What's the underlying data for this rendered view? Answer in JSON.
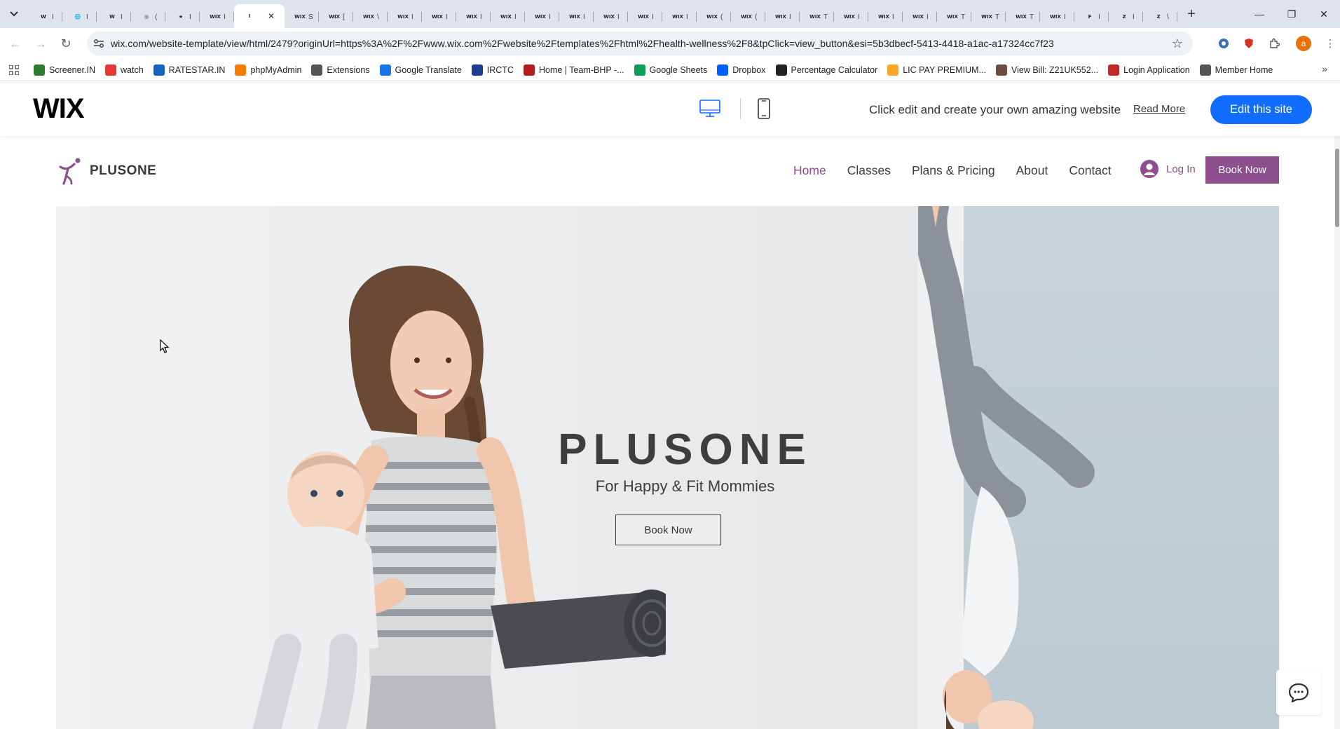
{
  "browser": {
    "tabs": [
      {
        "favicon": "W",
        "title": "I"
      },
      {
        "favicon": "🌐",
        "title": "I"
      },
      {
        "favicon": "W",
        "title": "I"
      },
      {
        "favicon": "◎",
        "title": "("
      },
      {
        "favicon": "★",
        "title": "I"
      },
      {
        "favicon": "WIX",
        "title": "I"
      },
      {
        "favicon": "I",
        "title": "",
        "active": true
      },
      {
        "favicon": "WIX",
        "title": "S"
      },
      {
        "favicon": "WIX",
        "title": "["
      },
      {
        "favicon": "WIX",
        "title": "\\"
      },
      {
        "favicon": "WIX",
        "title": "I"
      },
      {
        "favicon": "WIX",
        "title": "I"
      },
      {
        "favicon": "WIX",
        "title": "I"
      },
      {
        "favicon": "WIX",
        "title": "I"
      },
      {
        "favicon": "WIX",
        "title": "I"
      },
      {
        "favicon": "WIX",
        "title": "I"
      },
      {
        "favicon": "WIX",
        "title": "I"
      },
      {
        "favicon": "WIX",
        "title": "I"
      },
      {
        "favicon": "WIX",
        "title": "I"
      },
      {
        "favicon": "WIX",
        "title": "("
      },
      {
        "favicon": "WIX",
        "title": "("
      },
      {
        "favicon": "WIX",
        "title": "I"
      },
      {
        "favicon": "WIX",
        "title": "T"
      },
      {
        "favicon": "WIX",
        "title": "I"
      },
      {
        "favicon": "WIX",
        "title": "I"
      },
      {
        "favicon": "WIX",
        "title": "I"
      },
      {
        "favicon": "WIX",
        "title": "T"
      },
      {
        "favicon": "WIX",
        "title": "T"
      },
      {
        "favicon": "WIX",
        "title": "T"
      },
      {
        "favicon": "WIX",
        "title": "I"
      },
      {
        "favicon": "F",
        "title": "I"
      },
      {
        "favicon": "Z",
        "title": "I"
      },
      {
        "favicon": "Z",
        "title": "\\"
      }
    ],
    "url": "wix.com/website-template/view/html/2479?originUrl=https%3A%2F%2Fwww.wix.com%2Fwebsite%2Ftemplates%2Fhtml%2Fhealth-wellness%2F8&tpClick=view_button&esi=5b3dbecf-5413-4418-a1ac-a17324cc7f23",
    "profile_initial": "a",
    "bookmarks": [
      {
        "label": "Screener.IN",
        "icon": "bar-chart-icon",
        "color": "#2e7d32"
      },
      {
        "label": "watch",
        "icon": "youtube-icon",
        "color": "#e53935"
      },
      {
        "label": "RATESTAR.IN",
        "icon": "ratestar-icon",
        "color": "#1565c0"
      },
      {
        "label": "phpMyAdmin",
        "icon": "phpmyadmin-icon",
        "color": "#f57c00"
      },
      {
        "label": "Extensions",
        "icon": "puzzle-icon",
        "color": "#555555"
      },
      {
        "label": "Google Translate",
        "icon": "translate-icon",
        "color": "#1a73e8"
      },
      {
        "label": "IRCTC",
        "icon": "irctc-icon",
        "color": "#1a3f8f"
      },
      {
        "label": "Home | Team-BHP -...",
        "icon": "teambhp-icon",
        "color": "#b71c1c"
      },
      {
        "label": "Google Sheets",
        "icon": "sheets-icon",
        "color": "#0f9d58"
      },
      {
        "label": "Dropbox",
        "icon": "dropbox-icon",
        "color": "#0061fe"
      },
      {
        "label": "Percentage Calculator",
        "icon": "percent-icon",
        "color": "#222222"
      },
      {
        "label": "LIC PAY PREMIUM...",
        "icon": "lic-icon",
        "color": "#f9a825"
      },
      {
        "label": "View Bill: Z21UK552...",
        "icon": "bill-icon",
        "color": "#6d4c41"
      },
      {
        "label": "Login Application",
        "icon": "login-app-icon",
        "color": "#c62828"
      },
      {
        "label": "Member Home",
        "icon": "globe-icon",
        "color": "#555555"
      }
    ]
  },
  "wix_bar": {
    "logo": "WIX",
    "tagline": "Click edit and create your own amazing website",
    "read_more": "Read More",
    "edit_button": "Edit this site",
    "accent": "#116dff"
  },
  "site": {
    "brand_name": "PLUSONE",
    "nav": [
      {
        "label": "Home",
        "active": true
      },
      {
        "label": "Classes"
      },
      {
        "label": "Plans & Pricing"
      },
      {
        "label": "About"
      },
      {
        "label": "Contact"
      }
    ],
    "login_label": "Log In",
    "book_now_top": "Book Now",
    "brand_color": "#8d4f8d",
    "hero": {
      "title": "PLUSONE",
      "subtitle": "For Happy & Fit Mommies",
      "button": "Book Now"
    }
  }
}
